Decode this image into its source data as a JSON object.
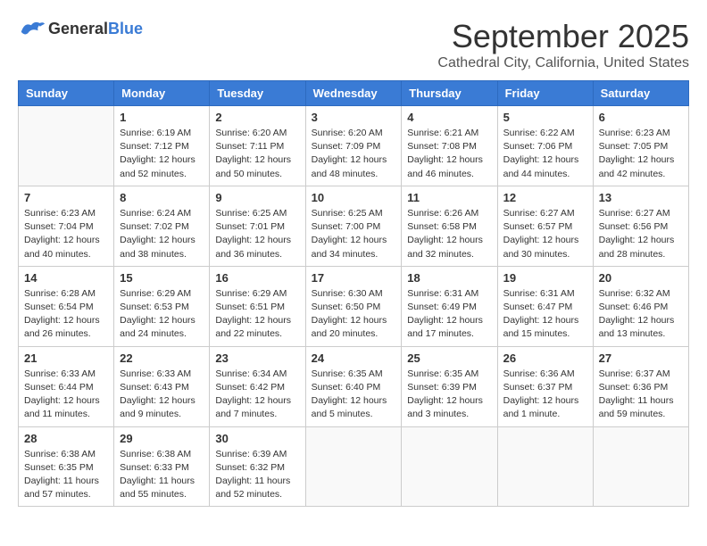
{
  "header": {
    "logo": {
      "general": "General",
      "blue": "Blue"
    },
    "title": "September 2025",
    "location": "Cathedral City, California, United States"
  },
  "calendar": {
    "days_of_week": [
      "Sunday",
      "Monday",
      "Tuesday",
      "Wednesday",
      "Thursday",
      "Friday",
      "Saturday"
    ],
    "weeks": [
      [
        {
          "day": "",
          "content": ""
        },
        {
          "day": "1",
          "content": "Sunrise: 6:19 AM\nSunset: 7:12 PM\nDaylight: 12 hours\nand 52 minutes."
        },
        {
          "day": "2",
          "content": "Sunrise: 6:20 AM\nSunset: 7:11 PM\nDaylight: 12 hours\nand 50 minutes."
        },
        {
          "day": "3",
          "content": "Sunrise: 6:20 AM\nSunset: 7:09 PM\nDaylight: 12 hours\nand 48 minutes."
        },
        {
          "day": "4",
          "content": "Sunrise: 6:21 AM\nSunset: 7:08 PM\nDaylight: 12 hours\nand 46 minutes."
        },
        {
          "day": "5",
          "content": "Sunrise: 6:22 AM\nSunset: 7:06 PM\nDaylight: 12 hours\nand 44 minutes."
        },
        {
          "day": "6",
          "content": "Sunrise: 6:23 AM\nSunset: 7:05 PM\nDaylight: 12 hours\nand 42 minutes."
        }
      ],
      [
        {
          "day": "7",
          "content": "Sunrise: 6:23 AM\nSunset: 7:04 PM\nDaylight: 12 hours\nand 40 minutes."
        },
        {
          "day": "8",
          "content": "Sunrise: 6:24 AM\nSunset: 7:02 PM\nDaylight: 12 hours\nand 38 minutes."
        },
        {
          "day": "9",
          "content": "Sunrise: 6:25 AM\nSunset: 7:01 PM\nDaylight: 12 hours\nand 36 minutes."
        },
        {
          "day": "10",
          "content": "Sunrise: 6:25 AM\nSunset: 7:00 PM\nDaylight: 12 hours\nand 34 minutes."
        },
        {
          "day": "11",
          "content": "Sunrise: 6:26 AM\nSunset: 6:58 PM\nDaylight: 12 hours\nand 32 minutes."
        },
        {
          "day": "12",
          "content": "Sunrise: 6:27 AM\nSunset: 6:57 PM\nDaylight: 12 hours\nand 30 minutes."
        },
        {
          "day": "13",
          "content": "Sunrise: 6:27 AM\nSunset: 6:56 PM\nDaylight: 12 hours\nand 28 minutes."
        }
      ],
      [
        {
          "day": "14",
          "content": "Sunrise: 6:28 AM\nSunset: 6:54 PM\nDaylight: 12 hours\nand 26 minutes."
        },
        {
          "day": "15",
          "content": "Sunrise: 6:29 AM\nSunset: 6:53 PM\nDaylight: 12 hours\nand 24 minutes."
        },
        {
          "day": "16",
          "content": "Sunrise: 6:29 AM\nSunset: 6:51 PM\nDaylight: 12 hours\nand 22 minutes."
        },
        {
          "day": "17",
          "content": "Sunrise: 6:30 AM\nSunset: 6:50 PM\nDaylight: 12 hours\nand 20 minutes."
        },
        {
          "day": "18",
          "content": "Sunrise: 6:31 AM\nSunset: 6:49 PM\nDaylight: 12 hours\nand 17 minutes."
        },
        {
          "day": "19",
          "content": "Sunrise: 6:31 AM\nSunset: 6:47 PM\nDaylight: 12 hours\nand 15 minutes."
        },
        {
          "day": "20",
          "content": "Sunrise: 6:32 AM\nSunset: 6:46 PM\nDaylight: 12 hours\nand 13 minutes."
        }
      ],
      [
        {
          "day": "21",
          "content": "Sunrise: 6:33 AM\nSunset: 6:44 PM\nDaylight: 12 hours\nand 11 minutes."
        },
        {
          "day": "22",
          "content": "Sunrise: 6:33 AM\nSunset: 6:43 PM\nDaylight: 12 hours\nand 9 minutes."
        },
        {
          "day": "23",
          "content": "Sunrise: 6:34 AM\nSunset: 6:42 PM\nDaylight: 12 hours\nand 7 minutes."
        },
        {
          "day": "24",
          "content": "Sunrise: 6:35 AM\nSunset: 6:40 PM\nDaylight: 12 hours\nand 5 minutes."
        },
        {
          "day": "25",
          "content": "Sunrise: 6:35 AM\nSunset: 6:39 PM\nDaylight: 12 hours\nand 3 minutes."
        },
        {
          "day": "26",
          "content": "Sunrise: 6:36 AM\nSunset: 6:37 PM\nDaylight: 12 hours\nand 1 minute."
        },
        {
          "day": "27",
          "content": "Sunrise: 6:37 AM\nSunset: 6:36 PM\nDaylight: 11 hours\nand 59 minutes."
        }
      ],
      [
        {
          "day": "28",
          "content": "Sunrise: 6:38 AM\nSunset: 6:35 PM\nDaylight: 11 hours\nand 57 minutes."
        },
        {
          "day": "29",
          "content": "Sunrise: 6:38 AM\nSunset: 6:33 PM\nDaylight: 11 hours\nand 55 minutes."
        },
        {
          "day": "30",
          "content": "Sunrise: 6:39 AM\nSunset: 6:32 PM\nDaylight: 11 hours\nand 52 minutes."
        },
        {
          "day": "",
          "content": ""
        },
        {
          "day": "",
          "content": ""
        },
        {
          "day": "",
          "content": ""
        },
        {
          "day": "",
          "content": ""
        }
      ]
    ]
  }
}
